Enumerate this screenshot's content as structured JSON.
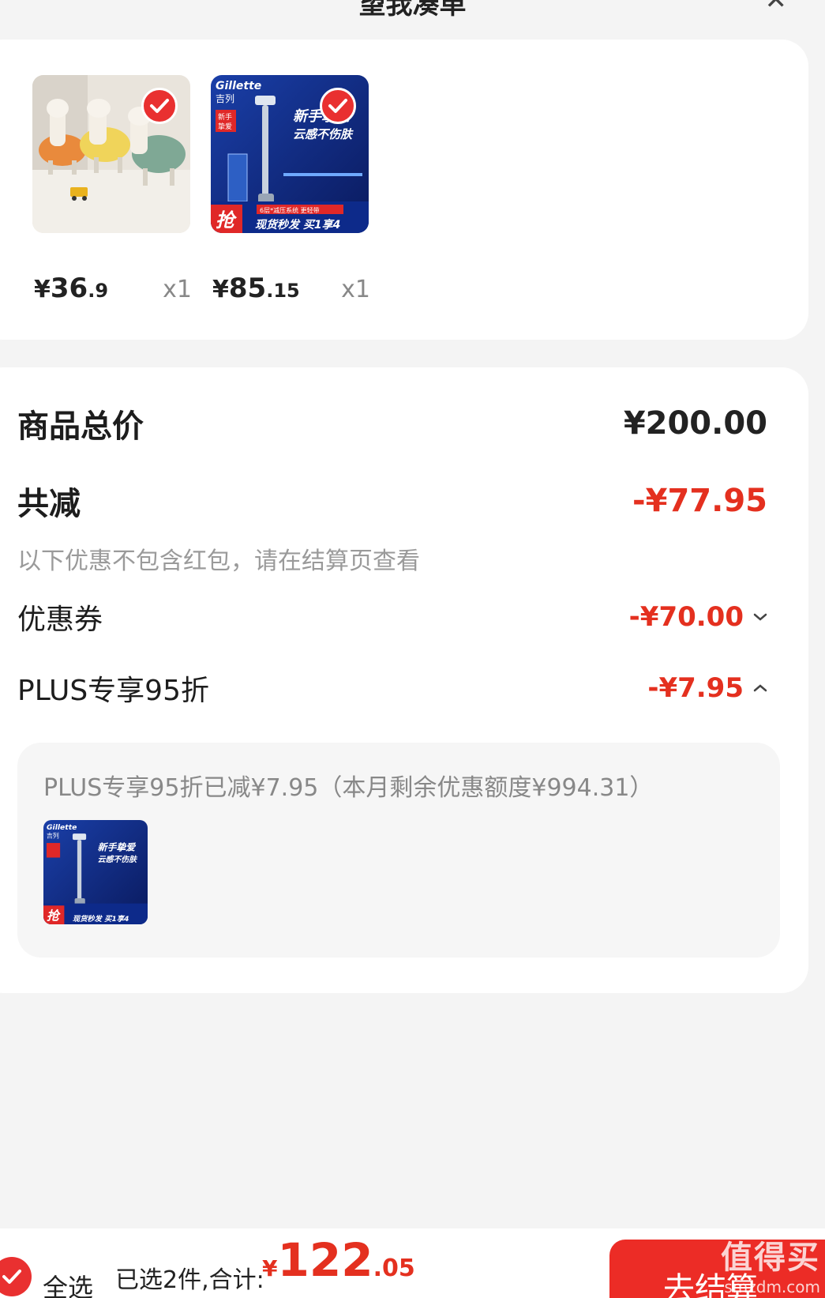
{
  "header": {
    "title": "望我凑单",
    "close_icon": "close-icon"
  },
  "products": [
    {
      "name": "alpaca-plush-toys",
      "price_yen": "¥",
      "price_int": "36",
      "price_dec": ".9",
      "qty": "x1",
      "selected": true
    },
    {
      "name": "gillette-razor",
      "price_yen": "¥",
      "price_int": "85",
      "price_dec": ".15",
      "qty": "x1",
      "selected": true,
      "image_text": {
        "brand_en": "Gillette",
        "brand_cn": "吉列",
        "badge": "新手挚爱",
        "tagline_1": "新手挚爱",
        "tagline_2": "云感不伤肤",
        "feature": "6层*减压系统 更轻带",
        "grab": "抢",
        "promo": "现货秒发 买1享4"
      }
    }
  ],
  "summary": {
    "total_label": "商品总价",
    "total_value": "¥200.00",
    "discount_label": "共减",
    "discount_value": "-¥77.95",
    "note": "以下优惠不包含红包，请在结算页查看",
    "coupon_label": "优惠券",
    "coupon_value": "-¥70.00",
    "plus_label": "PLUS专享95折",
    "plus_value": "-¥7.95",
    "plus_detail": "PLUS专享95折已减¥7.95（本月剩余优惠额度¥994.31）"
  },
  "bottom_bar": {
    "select_all": "全选",
    "selected_summary": "已选2件,合计:",
    "sum_yen": "¥",
    "sum_int": "122",
    "sum_dec": ".05",
    "checkout": "去结算",
    "watermark_big": "值得买",
    "watermark_small": "smzdm.com"
  },
  "colors": {
    "accent_red": "#e4301f",
    "check_red": "#e93030",
    "background": "#f4f4f4"
  }
}
